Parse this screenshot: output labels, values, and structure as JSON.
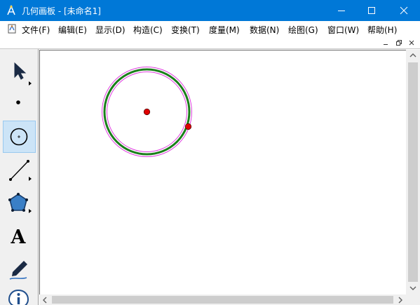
{
  "window": {
    "title": "几何画板 - [未命名1]"
  },
  "menu": {
    "items": [
      "文件(F)",
      "编辑(E)",
      "显示(D)",
      "构造(C)",
      "变换(T)",
      "度量(M)",
      "数据(N)",
      "绘图(G)",
      "窗口(W)",
      "帮助(H)"
    ]
  },
  "toolbox": {
    "tools": [
      {
        "icon": "arrow-select-icon"
      },
      {
        "icon": "point-tool-icon"
      },
      {
        "icon": "compass-circle-icon",
        "selected": true
      },
      {
        "icon": "straightedge-icon"
      },
      {
        "icon": "polygon-tool-icon"
      },
      {
        "label": "A",
        "icon": "text-tool-icon"
      },
      {
        "icon": "marker-pen-icon"
      },
      {
        "icon": "information-icon"
      }
    ]
  },
  "colors": {
    "titlebar": "#0078d7",
    "circle_stroke": "#1a7f1a",
    "selection_halo": "#e040e0",
    "point_fill": "#e00000"
  }
}
